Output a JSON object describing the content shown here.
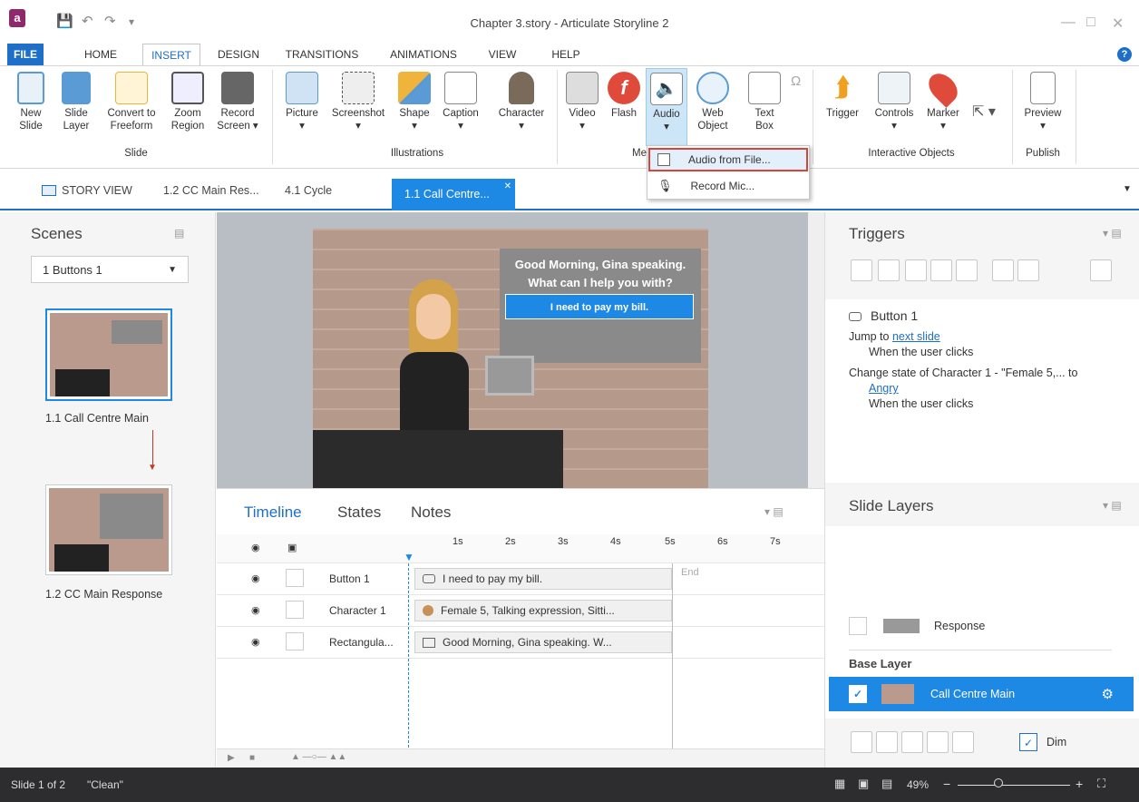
{
  "window": {
    "title": "Chapter 3.story - Articulate Storyline 2"
  },
  "menu": {
    "tabs": [
      "FILE",
      "HOME",
      "INSERT",
      "DESIGN",
      "TRANSITIONS",
      "ANIMATIONS",
      "VIEW",
      "HELP"
    ]
  },
  "ribbon": {
    "slide": {
      "new": [
        "New",
        "Slide"
      ],
      "layer": [
        "Slide",
        "Layer"
      ],
      "convert": [
        "Convert to",
        "Freeform"
      ],
      "zoom": [
        "Zoom",
        "Region"
      ],
      "record": [
        "Record",
        "Screen"
      ],
      "group": "Slide"
    },
    "illustrations": {
      "picture": "Picture",
      "screenshot": "Screenshot",
      "shape": "Shape",
      "caption": "Caption",
      "character": "Character",
      "group": "Illustrations"
    },
    "media": {
      "video": "Video",
      "flash": "Flash",
      "audio": "Audio",
      "web": [
        "Web",
        "Object"
      ],
      "textbox": [
        "Text",
        "Box"
      ],
      "group": "Me"
    },
    "interactive": {
      "trigger": "Trigger",
      "controls": "Controls",
      "marker": "Marker",
      "group": "Interactive Objects"
    },
    "publish": {
      "preview": "Preview",
      "group": "Publish"
    }
  },
  "audio_menu": {
    "items": [
      "Audio from File...",
      "Record Mic..."
    ]
  },
  "doc_tabs": {
    "story": "STORY VIEW",
    "t1": "1.2 CC Main Res...",
    "t2": "4.1 Cycle",
    "active": "1.1 Call Centre..."
  },
  "scenes": {
    "title": "Scenes",
    "selected": "1 Buttons 1",
    "slides": [
      "1.1 Call Centre Main",
      "1.2 CC Main Response"
    ]
  },
  "stage": {
    "speech": [
      "Good Morning, Gina speaking.",
      "What can I help you with?"
    ],
    "button": "I need to pay my bill."
  },
  "timeline": {
    "tabs": [
      "Timeline",
      "States",
      "Notes"
    ],
    "ticks": [
      "1s",
      "2s",
      "3s",
      "4s",
      "5s",
      "6s",
      "7s"
    ],
    "end_label": "End",
    "rows": [
      {
        "name": "Button 1",
        "bar": "I need to pay my bill."
      },
      {
        "name": "Character 1",
        "bar": "Female 5, Talking expression, Sitti..."
      },
      {
        "name": "Rectangula...",
        "bar": "Good Morning, Gina speaking.  W..."
      }
    ]
  },
  "triggers": {
    "title": "Triggers",
    "object": "Button 1",
    "t1_prefix": "Jump to ",
    "t1_link": "next slide",
    "t1_when": "When the user clicks",
    "t2_text": "Change state of Character 1 - \"Female 5,... to",
    "t2_link": "Angry",
    "t2_when": "When the user clicks"
  },
  "layers": {
    "title": "Slide Layers",
    "response": "Response",
    "base_label": "Base Layer",
    "base": "Call Centre Main",
    "dim": "Dim"
  },
  "status": {
    "slide": "Slide 1 of 2",
    "theme": "\"Clean\"",
    "zoom": "49%"
  },
  "colors": {
    "accent": "#1e6fc8",
    "highlight": "#d9433a",
    "layer_selected": "#1e88e5"
  }
}
